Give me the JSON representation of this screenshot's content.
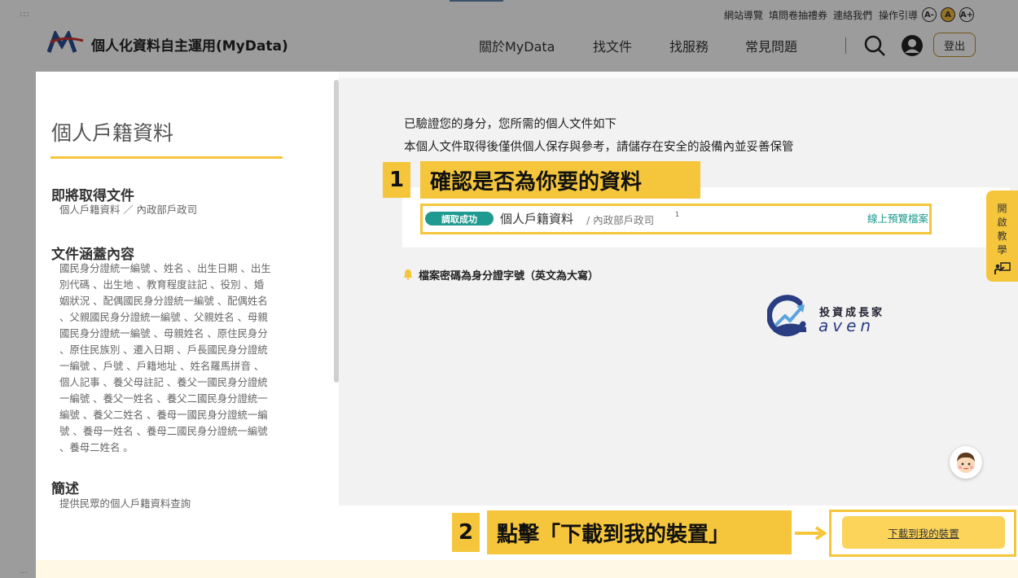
{
  "header": {
    "utility_links": [
      "網站導覽",
      "填問卷抽禮券",
      "連絡我們",
      "操作引導"
    ],
    "font_sizes": [
      "A-",
      "A",
      "A+"
    ],
    "site_name": "個人化資料自主運用(MyData)",
    "nav": [
      "關於MyData",
      "找文件",
      "找服務",
      "常見問題"
    ],
    "logout": "登出"
  },
  "left_panel": {
    "title": "個人戶籍資料",
    "sections": [
      {
        "heading": "即將取得文件",
        "body": "個人戶籍資料 ／ 內政部戶政司"
      },
      {
        "heading": "文件涵蓋內容",
        "lines": [
          "國民身分證統一編號 、姓名 、出生日期 、出生",
          "別代碼 、出生地 、教育程度註記 、役別 、婚",
          "姻狀況 、配偶國民身分證統一編號 、配偶姓名",
          "、父親國民身分證統一編號 、父親姓名 、母親",
          "國民身分證統一編號 、母親姓名 、原住民身分",
          "、原住民族別 、遷入日期 、戶長國民身分證統",
          "一編號 、戶號 、戶籍地址 、姓名羅馬拼音 、",
          "個人記事 、養父母註記 、養父一國民身分證統",
          "一編號 、養父一姓名 、養父二國民身分證統一",
          "編號 、養父二姓名 、養母一國民身分證統一編",
          "號 、養母一姓名 、養母二國民身分證統一編號",
          "、養母二姓名 。"
        ]
      },
      {
        "heading": "簡述",
        "body": "提供民眾的個人戶籍資料查詢"
      }
    ]
  },
  "main": {
    "intro_lines": [
      "已驗證您的身分，您所需的個人文件如下",
      "本個人文件取得後僅供個人保存與參考，請儲存在安全的設備內並妥善保管"
    ],
    "document": {
      "status": "調取成功",
      "name": "個人戶籍資料",
      "agency": "/ 內政部戶政司",
      "superscript": "1",
      "preview_link": "線上預覽檔案"
    },
    "password_note": "檔案密碼為身分證字號（英文為大寫）",
    "tutorial_tab": "開啟教學",
    "download_button": "下載到我的裝置"
  },
  "annotations": {
    "step1_num": "1",
    "step1_text": "確認是否為你要的資料",
    "step2_num": "2",
    "step2_text": "點擊「下載到我的裝置」"
  },
  "watermark": {
    "cn": "投資成長家",
    "en": "aven"
  },
  "colors": {
    "accent": "#f5c63b",
    "teal": "#1e9a90",
    "button": "#fcd45a"
  }
}
